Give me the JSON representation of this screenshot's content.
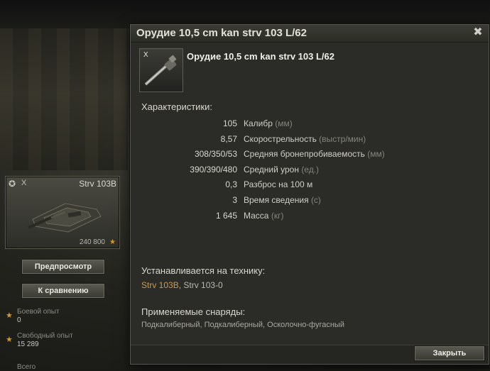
{
  "sidebar": {
    "vehicle": {
      "tier": "X",
      "name": "Strv 103B",
      "price": "240 800"
    },
    "preview_label": "Предпросмотр",
    "compare_label": "К сравнению",
    "combat_exp_label": "Боевой опыт",
    "combat_exp_value": "0",
    "free_exp_label": "Свободный опыт",
    "free_exp_value": "15 289",
    "cut_label": "Всего"
  },
  "dialog": {
    "title": "Орудие 10,5 cm kan strv 103 L/62",
    "module_tier": "X",
    "module_name": "Орудие 10,5 cm kan strv 103 L/62",
    "specs_heading": "Характеристики:",
    "specs": [
      {
        "value": "105",
        "label": "Калибр",
        "unit": "(мм)"
      },
      {
        "value": "8,57",
        "label": "Скорострельность",
        "unit": "(выстр/мин)"
      },
      {
        "value": "308/350/53",
        "label": "Средняя бронепробиваемость",
        "unit": "(мм)"
      },
      {
        "value": "390/390/480",
        "label": "Средний урон",
        "unit": "(ед.)"
      },
      {
        "value": "0,3",
        "label": "Разброс на 100 м",
        "unit": ""
      },
      {
        "value": "3",
        "label": "Время сведения",
        "unit": "(с)"
      },
      {
        "value": "1 645",
        "label": "Масса",
        "unit": "(кг)"
      }
    ],
    "installed_heading": "Устанавливается на технику:",
    "installed_main": "Strv 103B",
    "installed_sep": ", ",
    "installed_other": "Strv 103-0",
    "shells_heading": "Применяемые снаряды:",
    "shells": "Подкалиберный, Подкалиберный, Осколочно-фугасный",
    "close_label": "Закрыть"
  },
  "colors": {
    "accent_tank": "#c89a54",
    "gold": "#d59a2c"
  },
  "icons": [
    "close-icon",
    "nation-sweden-icon",
    "gun-module-icon",
    "star-icon",
    "credits-icon"
  ]
}
